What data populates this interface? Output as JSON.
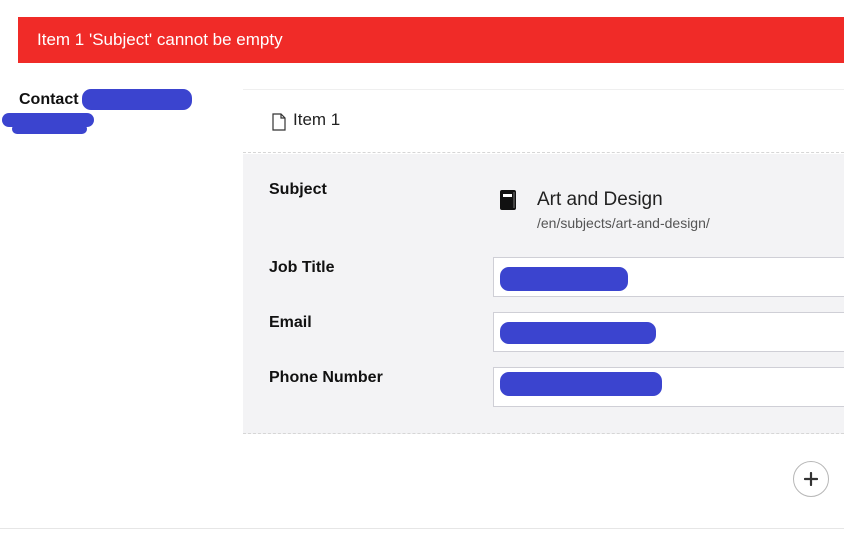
{
  "error": {
    "message": "Item 1 'Subject' cannot be empty"
  },
  "property": {
    "label": "Contact"
  },
  "item": {
    "title": "Item 1",
    "fields": {
      "subject_label": "Subject",
      "job_title_label": "Job Title",
      "email_label": "Email",
      "phone_label": "Phone Number"
    },
    "subject": {
      "name": "Art and Design",
      "path": "/en/subjects/art-and-design/",
      "icon": "book-icon"
    }
  },
  "icons": {
    "document": "document-icon",
    "add": "plus-icon"
  },
  "colors": {
    "error_bg": "#f02b28",
    "redaction": "#3b44cf",
    "panel_bg": "#f3f3f5"
  }
}
